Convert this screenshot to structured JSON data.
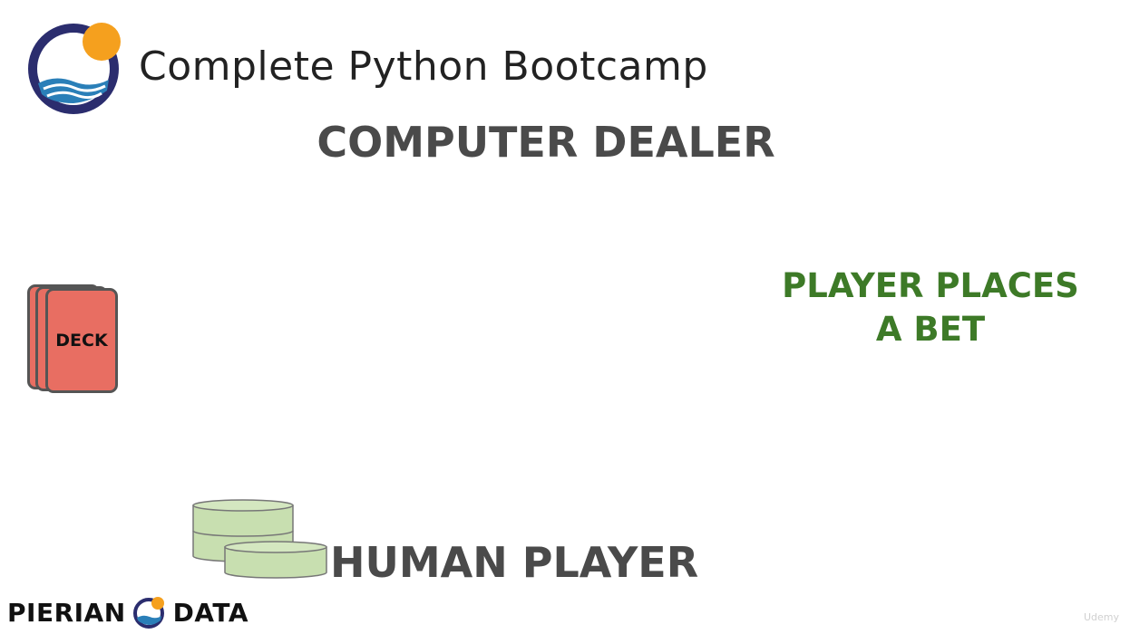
{
  "header": {
    "course_title": "Complete Python Bootcamp",
    "logo_icon": "python-bootcamp-logo-icon"
  },
  "table": {
    "dealer_label": "COMPUTER DEALER",
    "bet_label_line1": "PLAYER PLACES",
    "bet_label_line2": "A BET",
    "deck_label": "DECK",
    "player_label": "HUMAN PLAYER"
  },
  "brand": {
    "word_left": "PIERIAN",
    "word_right": "DATA",
    "logo_icon": "pierian-data-logo-icon"
  },
  "watermark": "Udemy",
  "colors": {
    "heading_gray": "#4a4a4a",
    "bet_green": "#3d7a27",
    "deck_red": "#e86e62",
    "chip_green": "#c8dfb0",
    "logo_navy": "#2b2d6e",
    "logo_orange": "#f5a01e",
    "logo_blue": "#2a7fb8"
  }
}
